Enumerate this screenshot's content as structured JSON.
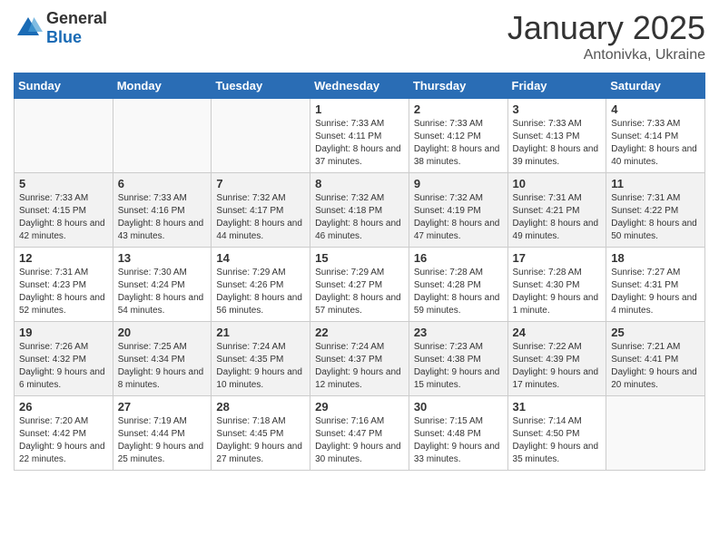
{
  "header": {
    "logo_general": "General",
    "logo_blue": "Blue",
    "month": "January 2025",
    "location": "Antonivka, Ukraine"
  },
  "weekdays": [
    "Sunday",
    "Monday",
    "Tuesday",
    "Wednesday",
    "Thursday",
    "Friday",
    "Saturday"
  ],
  "weeks": [
    [
      {
        "day": "",
        "info": ""
      },
      {
        "day": "",
        "info": ""
      },
      {
        "day": "",
        "info": ""
      },
      {
        "day": "1",
        "info": "Sunrise: 7:33 AM\nSunset: 4:11 PM\nDaylight: 8 hours and 37 minutes."
      },
      {
        "day": "2",
        "info": "Sunrise: 7:33 AM\nSunset: 4:12 PM\nDaylight: 8 hours and 38 minutes."
      },
      {
        "day": "3",
        "info": "Sunrise: 7:33 AM\nSunset: 4:13 PM\nDaylight: 8 hours and 39 minutes."
      },
      {
        "day": "4",
        "info": "Sunrise: 7:33 AM\nSunset: 4:14 PM\nDaylight: 8 hours and 40 minutes."
      }
    ],
    [
      {
        "day": "5",
        "info": "Sunrise: 7:33 AM\nSunset: 4:15 PM\nDaylight: 8 hours and 42 minutes."
      },
      {
        "day": "6",
        "info": "Sunrise: 7:33 AM\nSunset: 4:16 PM\nDaylight: 8 hours and 43 minutes."
      },
      {
        "day": "7",
        "info": "Sunrise: 7:32 AM\nSunset: 4:17 PM\nDaylight: 8 hours and 44 minutes."
      },
      {
        "day": "8",
        "info": "Sunrise: 7:32 AM\nSunset: 4:18 PM\nDaylight: 8 hours and 46 minutes."
      },
      {
        "day": "9",
        "info": "Sunrise: 7:32 AM\nSunset: 4:19 PM\nDaylight: 8 hours and 47 minutes."
      },
      {
        "day": "10",
        "info": "Sunrise: 7:31 AM\nSunset: 4:21 PM\nDaylight: 8 hours and 49 minutes."
      },
      {
        "day": "11",
        "info": "Sunrise: 7:31 AM\nSunset: 4:22 PM\nDaylight: 8 hours and 50 minutes."
      }
    ],
    [
      {
        "day": "12",
        "info": "Sunrise: 7:31 AM\nSunset: 4:23 PM\nDaylight: 8 hours and 52 minutes."
      },
      {
        "day": "13",
        "info": "Sunrise: 7:30 AM\nSunset: 4:24 PM\nDaylight: 8 hours and 54 minutes."
      },
      {
        "day": "14",
        "info": "Sunrise: 7:29 AM\nSunset: 4:26 PM\nDaylight: 8 hours and 56 minutes."
      },
      {
        "day": "15",
        "info": "Sunrise: 7:29 AM\nSunset: 4:27 PM\nDaylight: 8 hours and 57 minutes."
      },
      {
        "day": "16",
        "info": "Sunrise: 7:28 AM\nSunset: 4:28 PM\nDaylight: 8 hours and 59 minutes."
      },
      {
        "day": "17",
        "info": "Sunrise: 7:28 AM\nSunset: 4:30 PM\nDaylight: 9 hours and 1 minute."
      },
      {
        "day": "18",
        "info": "Sunrise: 7:27 AM\nSunset: 4:31 PM\nDaylight: 9 hours and 4 minutes."
      }
    ],
    [
      {
        "day": "19",
        "info": "Sunrise: 7:26 AM\nSunset: 4:32 PM\nDaylight: 9 hours and 6 minutes."
      },
      {
        "day": "20",
        "info": "Sunrise: 7:25 AM\nSunset: 4:34 PM\nDaylight: 9 hours and 8 minutes."
      },
      {
        "day": "21",
        "info": "Sunrise: 7:24 AM\nSunset: 4:35 PM\nDaylight: 9 hours and 10 minutes."
      },
      {
        "day": "22",
        "info": "Sunrise: 7:24 AM\nSunset: 4:37 PM\nDaylight: 9 hours and 12 minutes."
      },
      {
        "day": "23",
        "info": "Sunrise: 7:23 AM\nSunset: 4:38 PM\nDaylight: 9 hours and 15 minutes."
      },
      {
        "day": "24",
        "info": "Sunrise: 7:22 AM\nSunset: 4:39 PM\nDaylight: 9 hours and 17 minutes."
      },
      {
        "day": "25",
        "info": "Sunrise: 7:21 AM\nSunset: 4:41 PM\nDaylight: 9 hours and 20 minutes."
      }
    ],
    [
      {
        "day": "26",
        "info": "Sunrise: 7:20 AM\nSunset: 4:42 PM\nDaylight: 9 hours and 22 minutes."
      },
      {
        "day": "27",
        "info": "Sunrise: 7:19 AM\nSunset: 4:44 PM\nDaylight: 9 hours and 25 minutes."
      },
      {
        "day": "28",
        "info": "Sunrise: 7:18 AM\nSunset: 4:45 PM\nDaylight: 9 hours and 27 minutes."
      },
      {
        "day": "29",
        "info": "Sunrise: 7:16 AM\nSunset: 4:47 PM\nDaylight: 9 hours and 30 minutes."
      },
      {
        "day": "30",
        "info": "Sunrise: 7:15 AM\nSunset: 4:48 PM\nDaylight: 9 hours and 33 minutes."
      },
      {
        "day": "31",
        "info": "Sunrise: 7:14 AM\nSunset: 4:50 PM\nDaylight: 9 hours and 35 minutes."
      },
      {
        "day": "",
        "info": ""
      }
    ]
  ]
}
